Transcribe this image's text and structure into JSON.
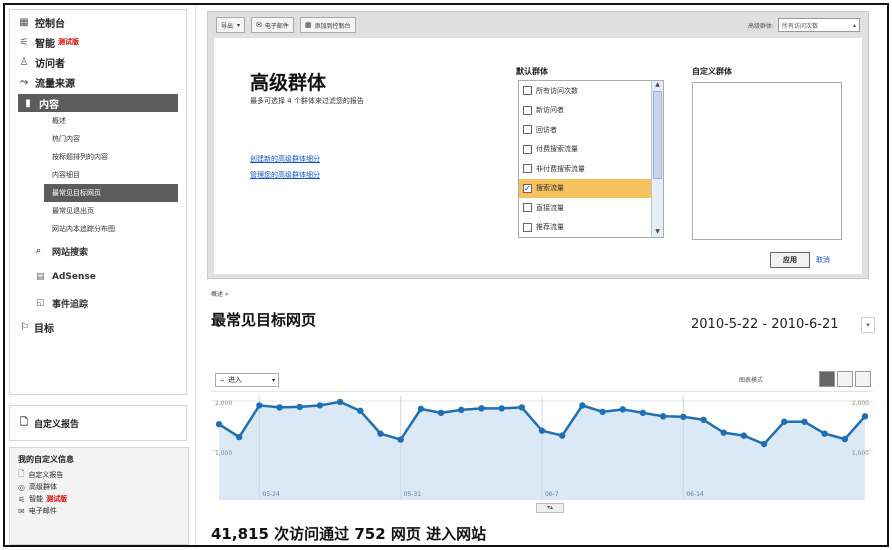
{
  "sidebar": {
    "items": [
      {
        "label": "控制台",
        "icon": "dashboard-icon"
      },
      {
        "label": "智能",
        "badge": "测试版",
        "icon": "intelligence-icon"
      },
      {
        "label": "访问者",
        "icon": "visitors-icon"
      },
      {
        "label": "流量来源",
        "icon": "traffic-sources-icon"
      }
    ],
    "section": {
      "label": "内容",
      "icon": "content-icon"
    },
    "sub_items": [
      "概述",
      "热门内容",
      "按标题排列的内容",
      "内容细目",
      "最常见目标网页",
      "最常见退出页",
      "网站内本追踪分布图"
    ],
    "active_sub_index": 4,
    "items2": [
      {
        "label": "网站搜索",
        "icon": "site-search-icon"
      },
      {
        "label": "AdSense",
        "icon": "adsense-icon"
      },
      {
        "label": "事件追踪",
        "icon": "event-tracking-icon"
      }
    ],
    "goal": {
      "label": "目标",
      "icon": "goal-flag-icon"
    },
    "custom_reports": "自定义报告",
    "info": {
      "title": "我的自定义信息",
      "rows": [
        {
          "label": "自定义报告",
          "icon": "report-icon"
        },
        {
          "label": "高级群体",
          "icon": "segment-icon"
        },
        {
          "label": "智能",
          "badge": "测试版",
          "icon": "intelligence-icon"
        },
        {
          "label": "电子邮件",
          "icon": "email-icon"
        }
      ]
    }
  },
  "segment": {
    "toolbar": {
      "export": "导出",
      "email": "电子邮件",
      "add_dashboard": "添加到控制台"
    },
    "segment_label": "高级群体:",
    "segment_select": "所有访问次数",
    "title": "高级群体",
    "subtitle": "最多可选择 4 个群体来过滤您的报告",
    "link_create": "创建新的高级群体细分",
    "link_manage": "管理您的高级群体细分",
    "default_title": "默认群体",
    "options": [
      {
        "label": "所有访问次数",
        "checked": false
      },
      {
        "label": "新访问者",
        "checked": false
      },
      {
        "label": "回访者",
        "checked": false
      },
      {
        "label": "付费搜索流量",
        "checked": false
      },
      {
        "label": "非付费搜索流量",
        "checked": false
      },
      {
        "label": "搜索流量",
        "checked": true
      },
      {
        "label": "直接流量",
        "checked": false
      },
      {
        "label": "推荐流量",
        "checked": false
      }
    ],
    "custom_title": "自定义群体",
    "apply": "应用",
    "cancel": "取消"
  },
  "report": {
    "breadcrumb": "概述 »",
    "title": "最常见目标网页",
    "date_range": "2010-5-22 - 2010-6-21",
    "metric": "进入",
    "graph_mode_label": "图表模式",
    "summary": "41,815 次访问通过 752 网页 进入网站"
  },
  "chart_data": {
    "type": "area",
    "x": [
      "5-22",
      "5-23",
      "5-24",
      "5-25",
      "5-26",
      "5-27",
      "5-28",
      "5-29",
      "5-30",
      "5-31",
      "6-1",
      "6-2",
      "6-3",
      "6-4",
      "6-5",
      "6-6",
      "6-7",
      "6-8",
      "6-9",
      "6-10",
      "6-11",
      "6-12",
      "6-13",
      "6-14",
      "6-15",
      "6-16",
      "6-17",
      "6-18",
      "6-19",
      "6-20",
      "6-21"
    ],
    "series": [
      {
        "values": [
          1530,
          1270,
          1910,
          1870,
          1880,
          1910,
          1980,
          1800,
          1340,
          1220,
          1840,
          1760,
          1820,
          1850,
          1850,
          1870,
          1400,
          1300,
          1910,
          1780,
          1830,
          1760,
          1690,
          1680,
          1620,
          1360,
          1300,
          1130,
          1580,
          1580,
          1340,
          1230,
          1690
        ]
      }
    ],
    "x_tick_labels": [
      "05-24",
      "05-31",
      "06-7",
      "06-14"
    ],
    "y_tick_labels": [
      "2,000",
      "1,000"
    ],
    "ylim": [
      0,
      2100
    ],
    "grid": true,
    "colors": {
      "line": "#1f6fb5",
      "fill": "#dbe9f6"
    }
  }
}
